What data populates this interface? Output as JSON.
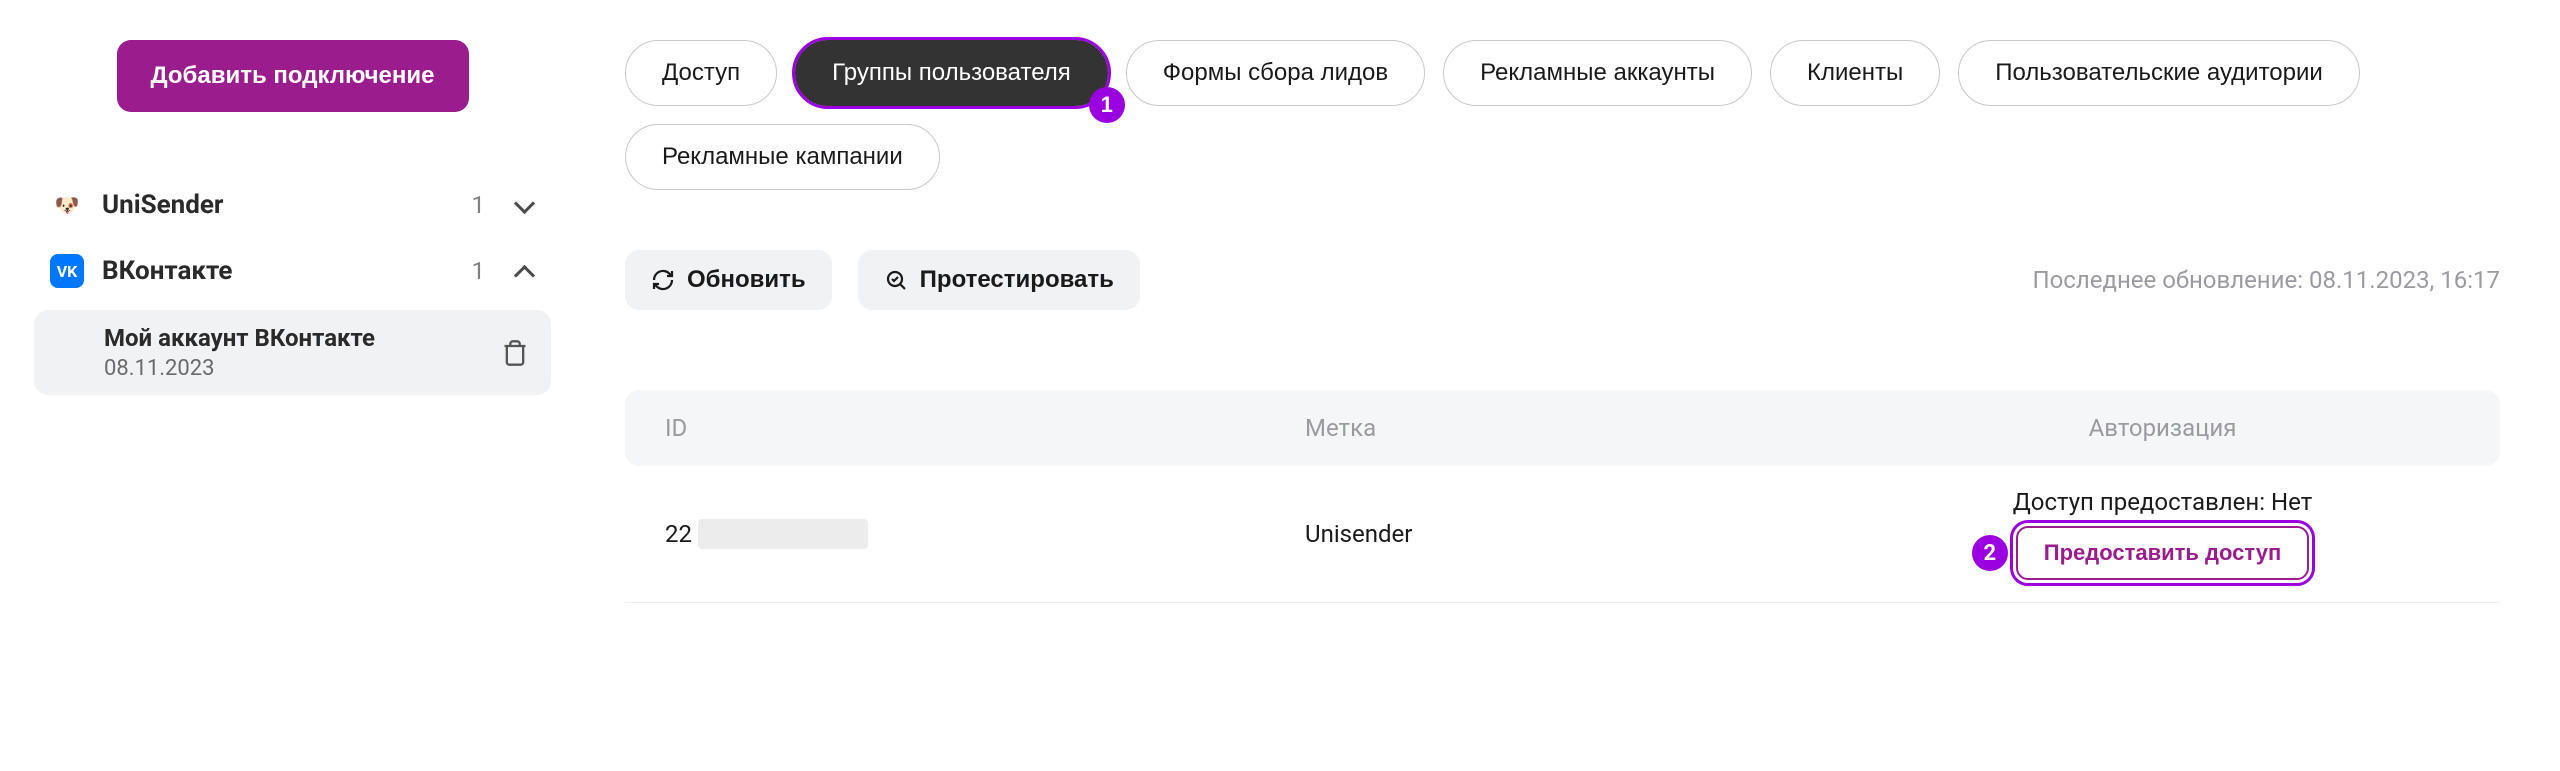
{
  "sidebar": {
    "add_connection_label": "Добавить подключение",
    "items": [
      {
        "icon": "icon-uni",
        "glyph": "🐶",
        "label": "UniSender",
        "count": "1",
        "expanded": false
      },
      {
        "icon": "icon-vk",
        "glyph": "VK",
        "label": "ВКонтакте",
        "count": "1",
        "expanded": true,
        "sub": {
          "title": "Мой аккаунт ВКонтакте",
          "date": "08.11.2023"
        }
      }
    ]
  },
  "tabs": [
    {
      "label": "Доступ",
      "active": false
    },
    {
      "label": "Группы пользователя",
      "active": true,
      "marker": "1"
    },
    {
      "label": "Формы сбора лидов",
      "active": false
    },
    {
      "label": "Рекламные аккаунты",
      "active": false
    },
    {
      "label": "Клиенты",
      "active": false
    },
    {
      "label": "Пользовательские аудитории",
      "active": false
    },
    {
      "label": "Рекламные кампании",
      "active": false
    }
  ],
  "actions": {
    "refresh_label": "Обновить",
    "test_label": "Протестировать",
    "last_update": "Последнее обновление: 08.11.2023, 16:17"
  },
  "table": {
    "headers": {
      "id": "ID",
      "label": "Метка",
      "auth": "Авторизация"
    },
    "row": {
      "id_prefix": "22",
      "label": "Unisender",
      "auth_status": "Доступ предоставлен: Нет",
      "grant_label": "Предоставить доступ",
      "grant_marker": "2"
    }
  }
}
